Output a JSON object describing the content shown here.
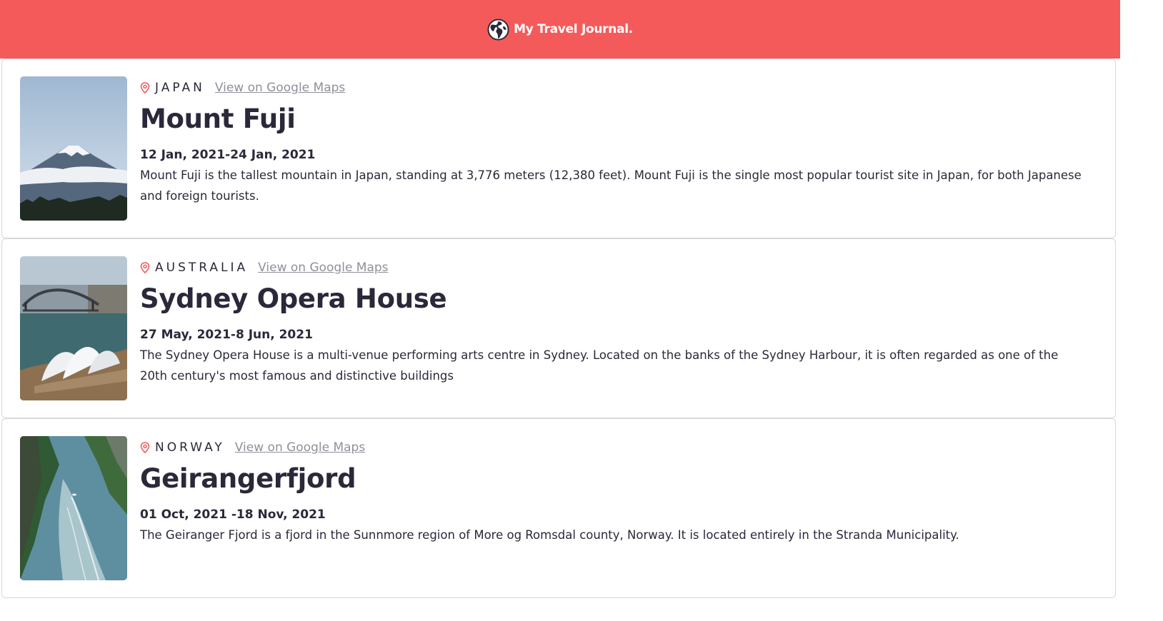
{
  "header": {
    "title": "My Travel Journal.",
    "icon": "globe-icon",
    "bg_color": "#f55a5a"
  },
  "entries": [
    {
      "country": "JAPAN",
      "maps_link": "View on Google Maps",
      "title": "Mount Fuji",
      "dates": "12 Jan, 2021-24 Jan, 2021",
      "description": "Mount Fuji is the tallest mountain in Japan, standing at 3,776 meters (12,380 feet). Mount Fuji is the single most popular tourist site in Japan, for both Japanese and foreign tourists."
    },
    {
      "country": "AUSTRALIA",
      "maps_link": "View on Google Maps",
      "title": "Sydney Opera House",
      "dates": "27 May, 2021-8 Jun, 2021",
      "description": "The Sydney Opera House is a multi-venue performing arts centre in Sydney. Located on the banks of the Sydney Harbour, it is often regarded as one of the 20th century's most famous and distinctive buildings"
    },
    {
      "country": "NORWAY",
      "maps_link": "View on Google Maps",
      "title": "Geirangerfjord",
      "dates": "01 Oct, 2021 -18 Nov, 2021",
      "description": "The Geiranger Fjord is a fjord in the Sunnmore region of More og Romsdal county, Norway. It is located entirely in the Stranda Municipality."
    }
  ],
  "colors": {
    "accent": "#f55a5a",
    "text": "#2b283a",
    "link": "#918e9b"
  }
}
